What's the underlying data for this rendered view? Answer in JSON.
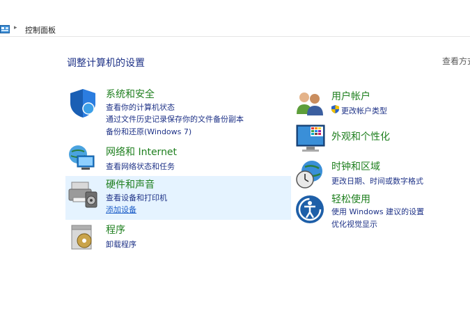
{
  "breadcrumb": {
    "label": "控制面板"
  },
  "heading": "调整计算机的设置",
  "view_by": "查看方式",
  "categories_left": [
    {
      "title": "系统和安全",
      "icon": "shield-icon",
      "links": [
        "查看你的计算机状态",
        "通过文件历史记录保存你的文件备份副本",
        "备份和还原(Windows 7)"
      ]
    },
    {
      "title": "网络和 Internet",
      "icon": "network-icon",
      "links": [
        "查看网络状态和任务"
      ]
    },
    {
      "title": "硬件和声音",
      "icon": "printer-icon",
      "links": [
        "查看设备和打印机",
        "添加设备"
      ]
    },
    {
      "title": "程序",
      "icon": "programs-icon",
      "links": [
        "卸载程序"
      ]
    }
  ],
  "categories_right": [
    {
      "title": "用户帐户",
      "icon": "users-icon",
      "links": [
        "更改帐户类型"
      ]
    },
    {
      "title": "外观和个性化",
      "icon": "display-icon",
      "links": []
    },
    {
      "title": "时钟和区域",
      "icon": "clock-globe-icon",
      "links": [
        "更改日期、时间或数字格式"
      ]
    },
    {
      "title": "轻松使用",
      "icon": "ease-of-access-icon",
      "links": [
        "使用 Windows 建议的设置",
        "优化视觉显示"
      ]
    }
  ]
}
